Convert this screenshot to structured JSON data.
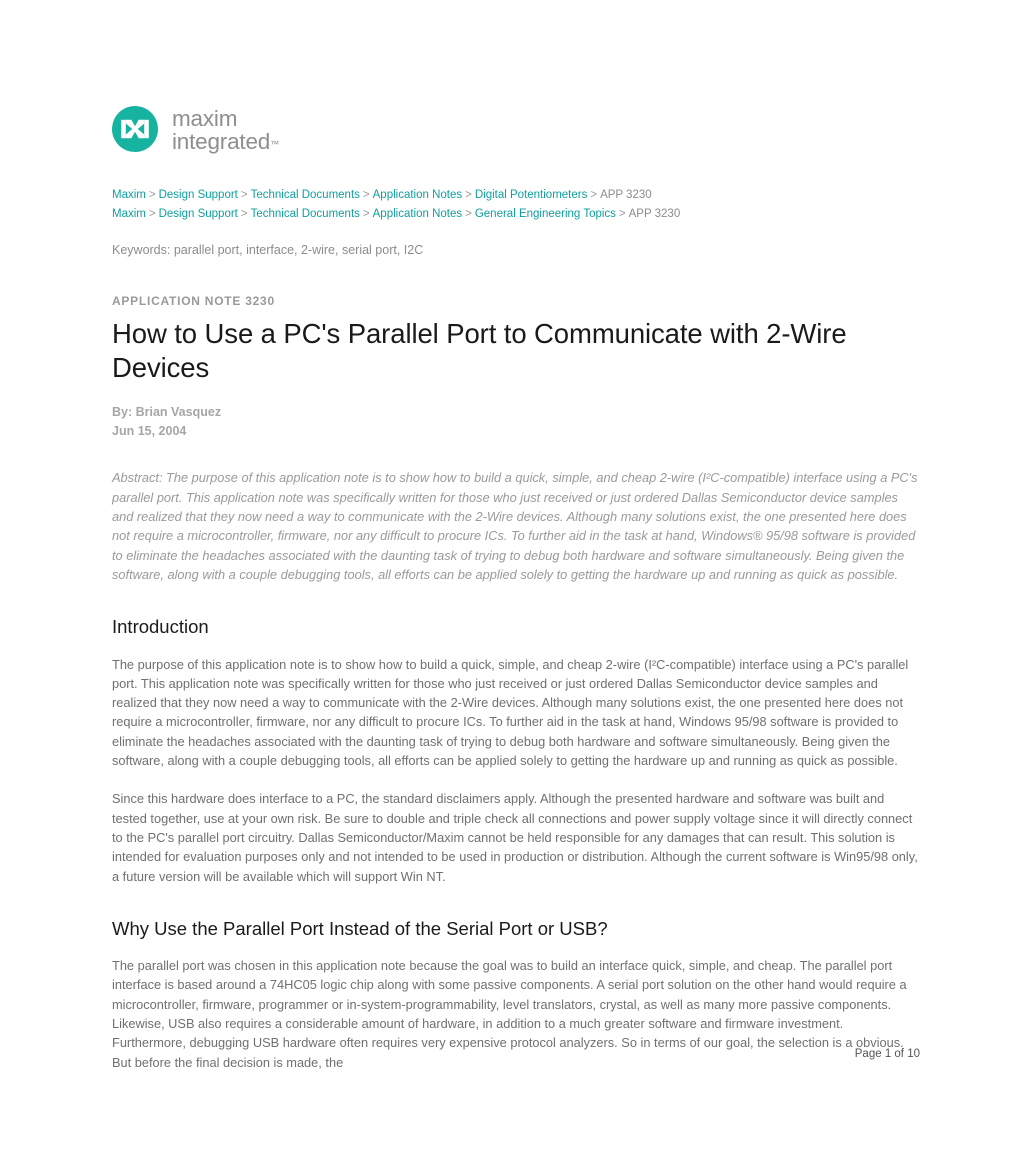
{
  "logo": {
    "mark_icon": "maxim-m-logo-icon",
    "mark_color": "#16b3a0",
    "wordmark_line1": "maxim",
    "wordmark_line2": "integrated",
    "wordmark_tm": "™"
  },
  "breadcrumbs": {
    "separator": ">",
    "link_color": "#0f9f9f",
    "rows": [
      {
        "links": [
          "Maxim",
          "Design Support",
          "Technical Documents",
          "Application Notes",
          "Digital Potentiometers"
        ],
        "current": "APP 3230"
      },
      {
        "links": [
          "Maxim",
          "Design Support",
          "Technical Documents",
          "Application Notes",
          "General Engineering Topics"
        ],
        "current": "APP 3230"
      }
    ]
  },
  "keywords": "Keywords: parallel port, interface, 2-wire, serial port, I2C",
  "document": {
    "label": "APPLICATION NOTE 3230",
    "title": "How to Use a PC's Parallel Port to Communicate with 2-Wire Devices",
    "author": "By: Brian Vasquez",
    "date": "Jun 15, 2004",
    "abstract": "Abstract: The purpose of this application note is to show how to build a quick, simple, and cheap 2-wire (I²C-compatible) interface using a PC's parallel port. This application note was specifically written for those who just received or just ordered Dallas Semiconductor device samples and realized that they now need a way to communicate with the 2-Wire devices. Although many solutions exist, the one presented here does not require a microcontroller, firmware, nor any difficult to procure ICs. To further aid in the task at hand, Windows® 95/98 software is provided to eliminate the headaches associated with the daunting task of trying to debug both hardware and software simultaneously. Being given the software, along with a couple debugging tools, all efforts can be applied solely to getting the hardware up and running as quick as possible."
  },
  "sections": [
    {
      "heading": "Introduction",
      "paragraphs": [
        "The purpose of this application note is to show how to build a quick, simple, and cheap 2-wire (I²C-compatible) interface using a PC's parallel port. This application note was specifically written for those who just received or just ordered Dallas Semiconductor device samples and realized that they now need a way to communicate with the 2-Wire devices. Although many solutions exist, the one presented here does not require a microcontroller, firmware, nor any difficult to procure ICs. To further aid in the task at hand, Windows 95/98 software is provided to eliminate the headaches associated with the daunting task of trying to debug both hardware and software simultaneously. Being given the software, along with a couple debugging tools, all efforts can be applied solely to getting the hardware up and running as quick as possible.",
        "Since this hardware does interface to a PC, the standard disclaimers apply. Although the presented hardware and software was built and tested together, use at your own risk. Be sure to double and triple check all connections and power supply voltage since it will directly connect to the PC's parallel port circuitry. Dallas Semiconductor/Maxim cannot be held responsible for any damages that can result. This solution is intended for evaluation purposes only and not intended to be used in production or distribution. Although the current software is Win95/98 only, a future version will be available which will support Win NT."
      ]
    },
    {
      "heading": "Why Use the Parallel Port Instead of the Serial Port or USB?",
      "paragraphs": [
        "The parallel port was chosen in this application note because the goal was to build an interface quick, simple, and cheap. The parallel port interface is based around a 74HC05 logic chip along with some passive components. A serial port solution on the other hand would require a microcontroller, firmware, programmer or in-system-programmability, level translators, crystal, as well as many more passive components. Likewise, USB also requires a considerable amount of hardware, in addition to a much greater software and firmware investment. Furthermore, debugging USB hardware often requires very expensive protocol analyzers. So in terms of our goal, the selection is a obvious. But before the final decision is made, the"
      ]
    }
  ],
  "footer": {
    "page_number": "Page 1 of 10"
  }
}
